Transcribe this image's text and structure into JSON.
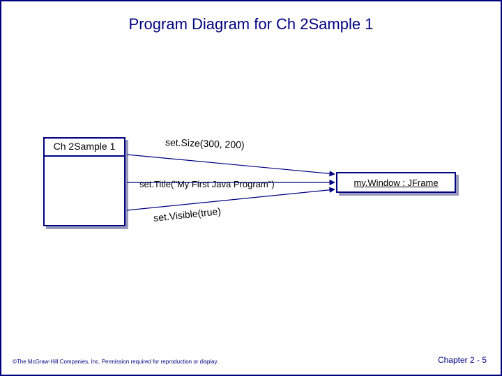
{
  "title": "Program Diagram for Ch 2Sample 1",
  "left_box_label": "Ch 2Sample 1",
  "right_box_label": "my.Window : JFrame",
  "messages": {
    "set_size": "set.Size(300, 200)",
    "set_title": "set.Title(\"My First Java Program\")",
    "set_visible": "set.Visible(true)"
  },
  "footer_left": "©The McGraw-Hill Companies, Inc. Permission required for reproduction or display.",
  "footer_right": "Chapter 2 - 5",
  "chart_data": {
    "type": "diagram",
    "sender": "Ch 2Sample 1",
    "receiver": "my.Window : JFrame",
    "calls": [
      {
        "method": "setSize",
        "args": "300, 200"
      },
      {
        "method": "setTitle",
        "args": "\"My First Java Program\""
      },
      {
        "method": "setVisible",
        "args": "true"
      }
    ]
  }
}
